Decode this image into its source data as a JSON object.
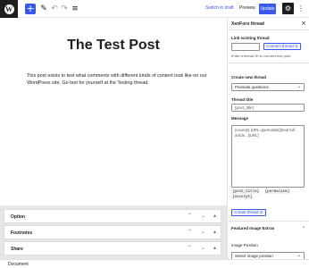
{
  "toolbar": {
    "logo": "W",
    "add_icon": "+",
    "pen_icon": "✎",
    "undo_icon": "↶",
    "redo_icon": "↷",
    "list_icon": "≡",
    "switch_to_draft": "Switch to draft",
    "preview": "Preview",
    "update": "Update",
    "settings_icon": "⚙",
    "more_icon": "⋮"
  },
  "post": {
    "title": "The Test Post",
    "body": "This post exists to test what comments with different kinds of content look like on our WordPress site. Go test for yourself at the Testing thread."
  },
  "metaboxes": [
    {
      "label": "Option"
    },
    {
      "label": "Footnotes"
    },
    {
      "label": "Share"
    }
  ],
  "metabox_controls": {
    "up": "⌃",
    "down": "⌄",
    "toggle": "▴"
  },
  "sidebar": {
    "title": "XenForo thread",
    "close_icon": "×",
    "link_label": "Link existing thread",
    "connect_button": "Connect thread",
    "link_hint": "Enter a thread ID to connect this post.",
    "create_label": "Create new thread",
    "forum_select": "Pinesale questions",
    "thread_title_label": "Thread title",
    "thread_title_value": "{post_title}",
    "message_label": "Message",
    "message_value": "{excerpt} [URL={permalink}]read full article...[/URL]",
    "tags": [
      "{post_title}",
      "{permalink}",
      "{excerpt}"
    ],
    "create_button": "Create thread",
    "featured_image_label": "Featured Image Extras",
    "image_position_label": "Image Position",
    "image_position_select": "Select image position"
  },
  "statusbar": {
    "breadcrumb": "Document"
  },
  "colors": {
    "accent": "#3858e9",
    "dark": "#1e1e1e",
    "meta_bg": "#e6e6e6"
  }
}
